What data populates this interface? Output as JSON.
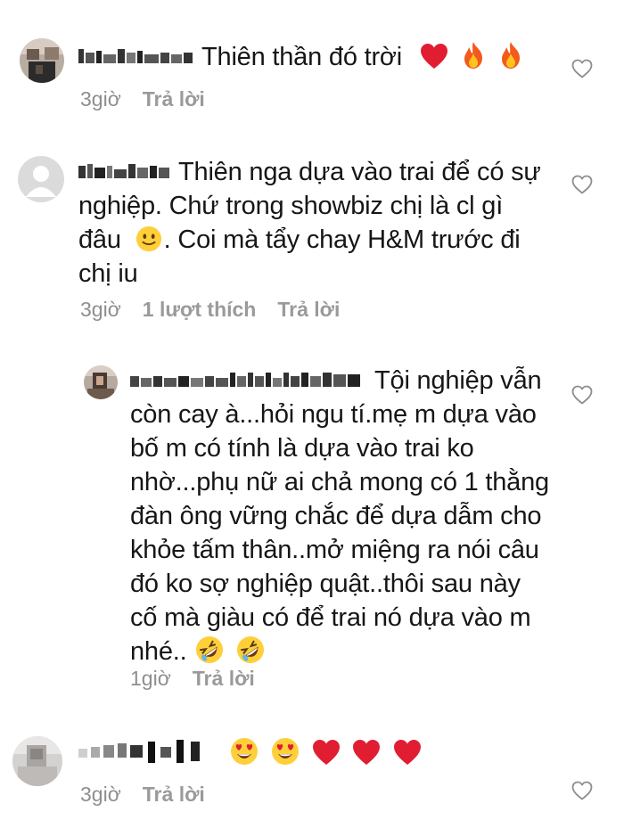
{
  "comments": [
    {
      "username_redacted": true,
      "text": "Thiên thần đó trời",
      "emojis": [
        "red-heart",
        "fire",
        "fire"
      ],
      "time": "3giờ",
      "reply_label": "Trả lời"
    },
    {
      "username_redacted": true,
      "text": "Thiên nga dựa vào trai để có sự nghiệp. Chứ trong showbiz chị là cl gì đâu",
      "emoji_inline": "slightly-smiling-face",
      "text_after": ". Coi mà tẩy chay H&M trước đi chị iu",
      "time": "3giờ",
      "likes": "1 lượt thích",
      "reply_label": "Trả lời"
    },
    {
      "is_reply": true,
      "username_redacted": true,
      "text": "Tội nghiệp vẫn còn cay à...hỏi ngu tí.mẹ m dựa vào bố m có tính là dựa vào trai ko nhờ...phụ nữ ai chả mong có 1 thằng đàn ông vững chắc để dựa dẫm cho khỏe tấm thân..mở miệng ra nói câu đó ko sợ nghiệp quật..thôi sau này cố mà giàu có để trai nó dựa vào m nhé..",
      "emojis": [
        "rolling-on-floor-laughing",
        "rolling-on-floor-laughing"
      ],
      "time": "1giờ",
      "reply_label": "Trả lời"
    },
    {
      "username_redacted": true,
      "emojis": [
        "heart-eyes",
        "heart-eyes",
        "red-heart",
        "red-heart",
        "red-heart"
      ],
      "time": "3giờ",
      "reply_label": "Trả lời"
    }
  ],
  "colors": {
    "meta": "#8e8e8e",
    "heart_emoji": "#e0213b",
    "like_icon": "#8e8e8e"
  }
}
